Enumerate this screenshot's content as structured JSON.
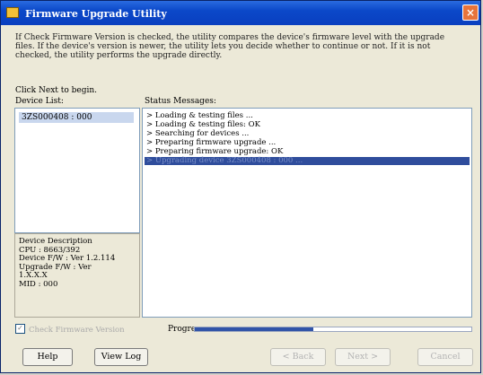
{
  "window": {
    "title": "Firmware Upgrade Utility",
    "close_glyph": "×"
  },
  "intro": {
    "text": "If Check Firmware Version is checked, the utility compares the device's firmware level with the upgrade files. If the device's version is newer, the utility lets you decide whether to continue or not. If it is not checked, the utility performs the upgrade directly."
  },
  "labels": {
    "click_next": "Click Next to begin.",
    "device_list": "Device List:",
    "status_messages": "Status Messages:"
  },
  "device_list": {
    "items": [
      {
        "label": "3ZS000408 : 000"
      }
    ]
  },
  "device_description": {
    "title": "Device Description",
    "lines": [
      "CPU : 8663/392",
      "Device F/W : Ver 1.2.114",
      "Upgrade F/W : Ver",
      "1.X.X.X",
      "MID : 000"
    ]
  },
  "status_messages": {
    "lines": [
      "> Loading & testing files ...",
      "> Loading & testing files: OK",
      "> Searching for devices ...",
      "> Preparing firmware upgrade ...",
      "> Preparing firmware upgrade: OK",
      "> Upgrading device 3ZS000408 : 000 ..."
    ],
    "selected_index": 5
  },
  "check_firmware": {
    "label": "Check Firmware Version",
    "checked": true,
    "check_glyph": "✓"
  },
  "progress": {
    "label": "Progress:",
    "fraction": 0.43
  },
  "buttons": {
    "help": "Help",
    "view_log": "View Log",
    "back": "< Back",
    "next": "Next >",
    "cancel": "Cancel"
  },
  "colors": {
    "title_bar": "#0b48c9",
    "selection": "#2f4d9c",
    "progress_fill": "#3154a8"
  }
}
